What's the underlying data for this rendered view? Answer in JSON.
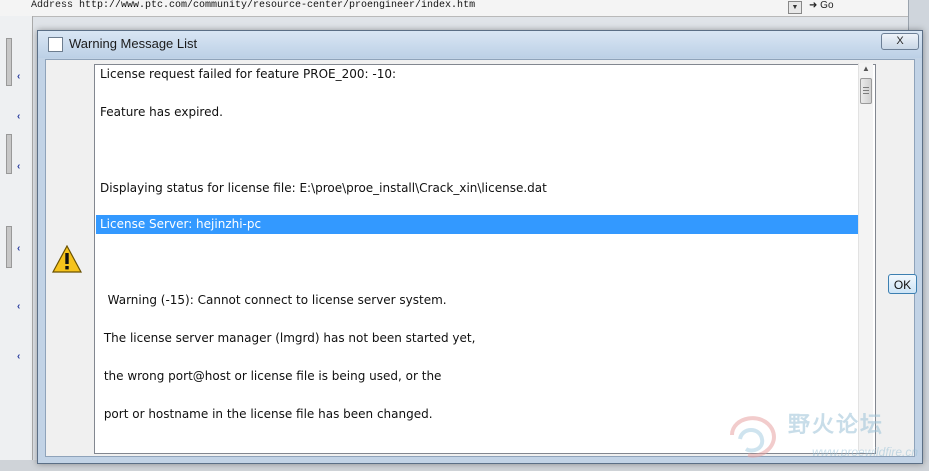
{
  "browser": {
    "address_label": "Address",
    "address_url": "http://www.ptc.com/community/resource-center/proengineer/index.htm",
    "go_label": "Go"
  },
  "dialog": {
    "title": "Warning Message List",
    "close_label": "X",
    "ok_label": "OK",
    "icon": "warning-triangle-icon",
    "selected_index": 4,
    "colors": {
      "selection": "#3399ff",
      "title_bar": "#c2d3e6"
    },
    "messages": [
      "License request failed for feature PROE_200: -10:",
      "Feature has expired.",
      "",
      "Displaying status for license file: E:\\proe\\proe_install\\Crack_xin\\license.dat",
      "License Server: hejinzhi-pc",
      "",
      "  Warning (-15): Cannot connect to license server system.",
      " The license server manager (lmgrd) has not been started yet,",
      " the wrong port@host or license file is being used, or the",
      " port or hostname in the license file has been changed."
    ]
  },
  "watermark": {
    "text_cn": "野火论坛",
    "url": "www.proewildfire.cn"
  }
}
